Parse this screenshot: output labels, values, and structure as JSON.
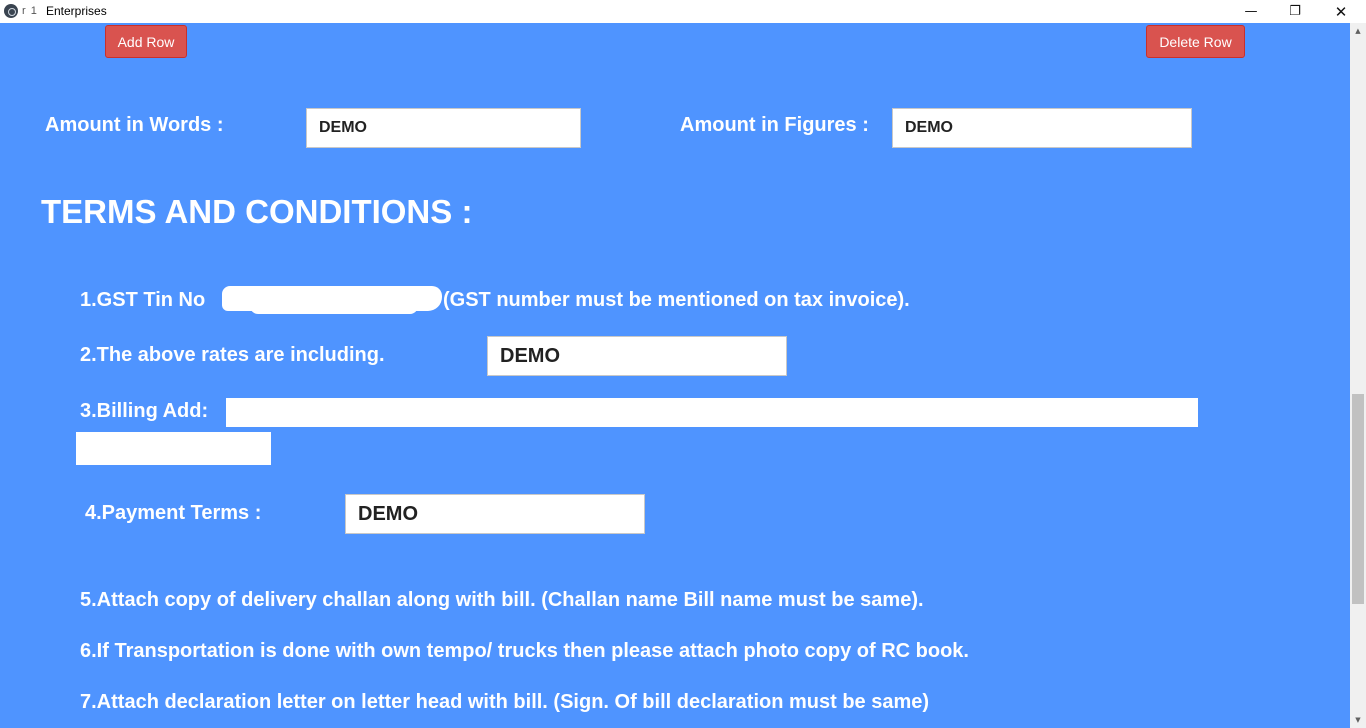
{
  "window": {
    "title_prefix": "r 1",
    "title": "Enterprises",
    "minimize_glyph": "—",
    "maximize_glyph": "❐",
    "close_glyph": "✕"
  },
  "toolbar": {
    "add_row_label": "Add Row",
    "delete_row_label": "Delete Row"
  },
  "amounts": {
    "words_label": "Amount in Words :",
    "words_value": "DEMO",
    "figures_label": "Amount in Figures :",
    "figures_value": "DEMO"
  },
  "terms": {
    "heading": "TERMS AND CONDITIONS :",
    "gst_prefix": "1.GST Tin No",
    "gst_suffix": "(GST number must be mentioned on tax invoice).",
    "rates_label": "2.The above rates are including.",
    "rates_value": "DEMO",
    "billing_label": "3.Billing Add:",
    "billing_value": "",
    "billing_value_2": "",
    "payment_label": "4.Payment Terms :",
    "payment_value": "DEMO",
    "item5": "5.Attach copy of delivery challan along with bill. (Challan name  Bill name must be same).",
    "item6": "6.If Transportation is done with own tempo/ trucks then please attach photo copy of RC book.",
    "item7": "7.Attach declaration letter on letter head with bill. (Sign. Of bill  declaration must be same)"
  },
  "scrollbar": {
    "up_glyph": "▲",
    "down_glyph": "▼"
  },
  "colors": {
    "page_background": "#4f94ff",
    "button_red": "#d9534f",
    "text_white": "#ffffff"
  }
}
